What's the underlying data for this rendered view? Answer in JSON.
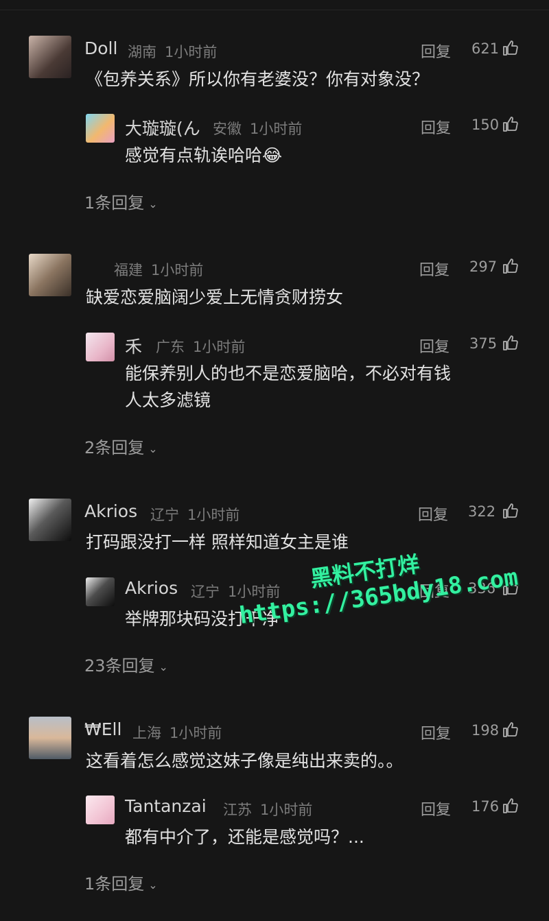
{
  "reply_label": "回复",
  "threads": [
    {
      "comment": {
        "name": "Doll",
        "location": "湖南",
        "time": "1小时前",
        "likes": "621",
        "text": "《包养关系》所以你有老婆没？你有对象没？"
      },
      "reply": {
        "name": "大璇璇(ん",
        "location": "安徽",
        "time": "1小时前",
        "likes": "150",
        "text": "感觉有点轨诶哈哈😂"
      },
      "more": "1条回复"
    },
    {
      "comment": {
        "name": "",
        "location": "福建",
        "time": "1小时前",
        "likes": "297",
        "text": "缺爱恋爱脑阔少爱上无情贪财捞女"
      },
      "reply": {
        "name": "禾",
        "location": "广东",
        "time": "1小时前",
        "likes": "375",
        "text1": "能保养别人的也不是恋爱脑哈，不必对有钱",
        "text2": "人太多滤镜"
      },
      "more": "2条回复"
    },
    {
      "comment": {
        "name": "Akrios",
        "location": "辽宁",
        "time": "1小时前",
        "likes": "322",
        "text": "打码跟没打一样 照样知道女主是谁"
      },
      "reply": {
        "name": "Akrios",
        "location": "辽宁",
        "time": "1小时前",
        "likes": "336",
        "text": "举牌那块码没打干净"
      },
      "more": "23条回复"
    },
    {
      "comment": {
        "name": "₩Ell",
        "location": "上海",
        "time": "1小时前",
        "likes": "198",
        "text": "这看着怎么感觉这妹子像是纯出来卖的。。"
      },
      "reply": {
        "name": "Tantanzai",
        "location": "江苏",
        "time": "1小时前",
        "likes": "176",
        "text": "都有中介了，还能是感觉吗？..."
      },
      "more": "1条回复"
    }
  ],
  "watermark": {
    "line1": "黑料不打烊",
    "line2": "https://365bdy18.com"
  },
  "colors": {
    "background": "#161616",
    "watermark": "#33f0a0"
  }
}
